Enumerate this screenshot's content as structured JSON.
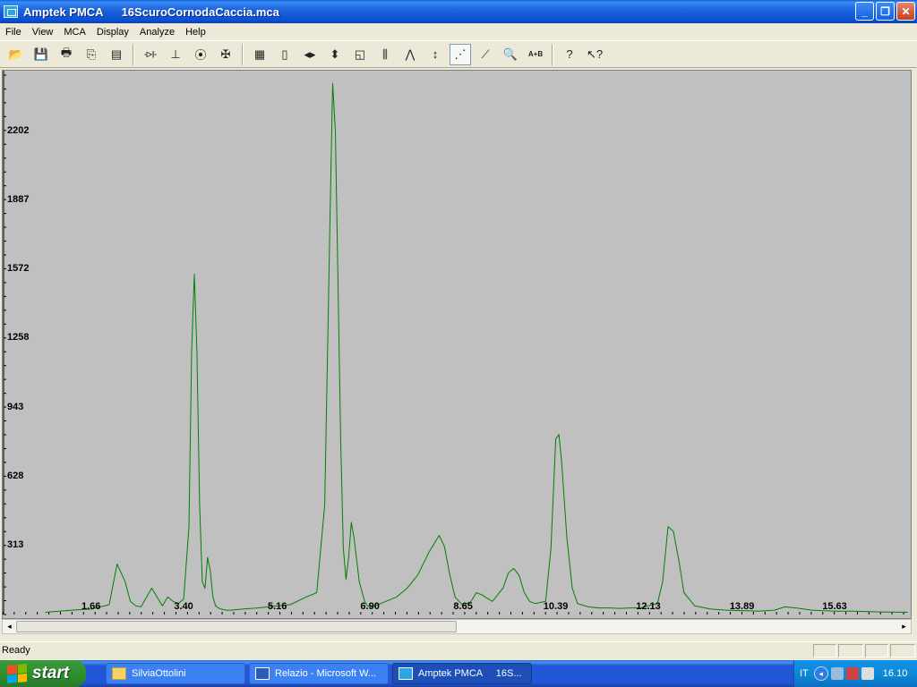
{
  "window": {
    "app_name": "Amptek PMCA",
    "file_name": "16ScuroCornodaCaccia.mca",
    "minimize": "_",
    "restore": "❐",
    "close": "✕"
  },
  "menu": [
    "File",
    "View",
    "MCA",
    "Display",
    "Analyze",
    "Help"
  ],
  "toolbar": {
    "buttons": [
      {
        "icon": "open-folder-icon",
        "glyph": "📂"
      },
      {
        "icon": "save-icon",
        "glyph": "💾"
      },
      {
        "icon": "print-icon",
        "glyph": "🖶"
      },
      {
        "icon": "copy-icon",
        "glyph": "⎘"
      },
      {
        "icon": "properties-icon",
        "glyph": "▤"
      },
      {
        "icon": "connect-icon",
        "glyph": "-▷|-"
      },
      {
        "icon": "acquire-icon",
        "glyph": "⊥"
      },
      {
        "icon": "traffic-light-icon",
        "glyph": "⦿"
      },
      {
        "icon": "tools-icon",
        "glyph": "✠"
      },
      {
        "icon": "spectrum-book-icon",
        "glyph": "▦"
      },
      {
        "icon": "document-icon",
        "glyph": "▯"
      },
      {
        "icon": "horizontal-arrows-icon",
        "glyph": "◂▸"
      },
      {
        "icon": "vertical-arrows-icon",
        "glyph": "⬍"
      },
      {
        "icon": "roi-icon",
        "glyph": "◱"
      },
      {
        "icon": "bar-icon",
        "glyph": "⫼"
      },
      {
        "icon": "peaks-icon",
        "glyph": "⋀"
      },
      {
        "icon": "log-scale-icon",
        "glyph": "↕"
      },
      {
        "icon": "points-icon",
        "glyph": "⋰"
      },
      {
        "icon": "line-icon",
        "glyph": "⟋"
      },
      {
        "icon": "zoom-icon",
        "glyph": "🔍"
      },
      {
        "icon": "a-plus-b-icon",
        "glyph": "A+B"
      },
      {
        "icon": "help-icon",
        "glyph": "?"
      },
      {
        "icon": "context-help-icon",
        "glyph": "↖?"
      }
    ]
  },
  "status": {
    "text": "Ready"
  },
  "taskbar": {
    "start_label": "start",
    "tasks": [
      "SilviaOttolini",
      "Relazio - Microsoft W...",
      "Amptek PMCA     16S..."
    ],
    "tray": {
      "lang": "IT",
      "clock": "16.10"
    }
  },
  "colors": {
    "plot_bg": "#c0c0c0",
    "trace": "#008000"
  },
  "chart_data": {
    "type": "line",
    "title": "",
    "xlabel": "",
    "ylabel": "",
    "x_ticks": [
      "1.66",
      "3.40",
      "5.16",
      "6.90",
      "8.65",
      "10.39",
      "12.13",
      "13.89",
      "15.63"
    ],
    "y_ticks": [
      "313",
      "628",
      "943",
      "1258",
      "1572",
      "1887",
      "2202"
    ],
    "xlim": [
      0.0,
      17.06
    ],
    "ylim": [
      0,
      2461
    ],
    "grid": false,
    "legend": "none",
    "series": [
      {
        "x": [
          0.8,
          1.3,
          1.66,
          2.0,
          2.15,
          2.3,
          2.4,
          2.5,
          2.6,
          2.8,
          2.9,
          3.0,
          3.1,
          3.2,
          3.3,
          3.4,
          3.5,
          3.55,
          3.6,
          3.65,
          3.7,
          3.75,
          3.8,
          3.85,
          3.9,
          3.95,
          4.0,
          4.05,
          4.1,
          4.2,
          4.3,
          4.5,
          4.8,
          5.16,
          5.4,
          5.7,
          5.9,
          6.05,
          6.15,
          6.2,
          6.25,
          6.3,
          6.35,
          6.4,
          6.45,
          6.5,
          6.55,
          6.6,
          6.7,
          6.8,
          6.85,
          6.9,
          7.0,
          7.1,
          7.2,
          7.4,
          7.6,
          7.8,
          8.0,
          8.2,
          8.3,
          8.4,
          8.5,
          8.65,
          8.8,
          8.9,
          9.0,
          9.2,
          9.4,
          9.5,
          9.6,
          9.7,
          9.8,
          9.9,
          10.0,
          10.2,
          10.3,
          10.39,
          10.45,
          10.5,
          10.6,
          10.7,
          10.8,
          11.0,
          11.2,
          11.4,
          11.6,
          11.8,
          12.0,
          12.13,
          12.3,
          12.4,
          12.5,
          12.6,
          12.7,
          12.8,
          13.0,
          13.3,
          13.6,
          13.89,
          14.2,
          14.5,
          14.7,
          14.9,
          15.2,
          15.63,
          16.0,
          16.5,
          17.0
        ],
        "values": [
          10,
          20,
          25,
          45,
          230,
          150,
          60,
          40,
          35,
          120,
          80,
          40,
          80,
          60,
          50,
          70,
          400,
          1200,
          1550,
          1200,
          500,
          150,
          120,
          260,
          200,
          80,
          40,
          30,
          25,
          20,
          20,
          25,
          30,
          40,
          45,
          80,
          100,
          500,
          1800,
          2420,
          2200,
          1500,
          800,
          300,
          160,
          260,
          420,
          350,
          150,
          60,
          40,
          35,
          40,
          50,
          60,
          80,
          120,
          180,
          280,
          360,
          310,
          180,
          80,
          40,
          60,
          100,
          90,
          60,
          120,
          190,
          210,
          180,
          100,
          60,
          50,
          60,
          300,
          800,
          820,
          700,
          350,
          120,
          50,
          35,
          30,
          30,
          28,
          30,
          30,
          40,
          50,
          150,
          400,
          380,
          250,
          100,
          40,
          25,
          20,
          18,
          15,
          20,
          35,
          30,
          20,
          15,
          15,
          12,
          10
        ]
      }
    ]
  }
}
